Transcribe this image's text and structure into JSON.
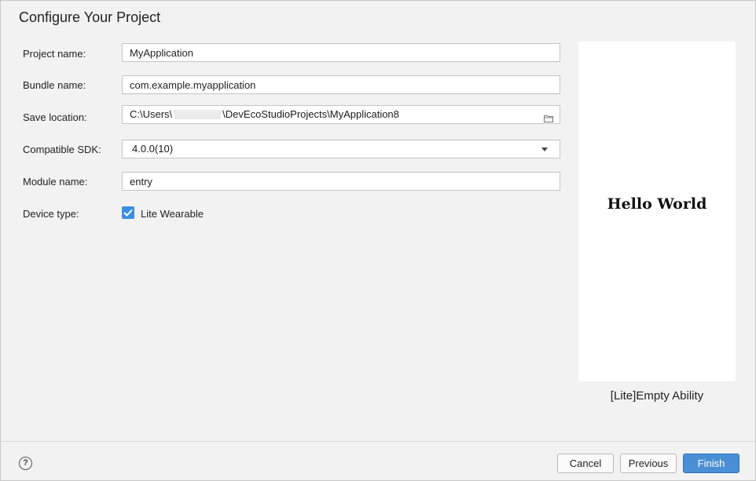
{
  "dialog": {
    "title": "Configure Your Project"
  },
  "form": {
    "project_name": {
      "label": "Project name:",
      "value": "MyApplication"
    },
    "bundle_name": {
      "label": "Bundle name:",
      "value": "com.example.myapplication"
    },
    "save_location": {
      "label": "Save location:",
      "prefix": "C:\\Users\\",
      "suffix": "\\DevEcoStudioProjects\\MyApplication8",
      "icon": "folder-icon"
    },
    "compatible_sdk": {
      "label": "Compatible SDK:",
      "value": "4.0.0(10)"
    },
    "module_name": {
      "label": "Module name:",
      "value": "entry"
    },
    "device_type": {
      "label": "Device type:",
      "option_label": "Lite Wearable",
      "checked": true
    }
  },
  "preview": {
    "screen_text": "Hello World",
    "template_name": "[Lite]Empty Ability"
  },
  "footer": {
    "help_icon": "?",
    "cancel_label": "Cancel",
    "previous_label": "Previous",
    "finish_label": "Finish"
  },
  "colors": {
    "accent": "#3c8ee0",
    "primary_button": "#4a8fd6",
    "background": "#f2f2f2"
  }
}
